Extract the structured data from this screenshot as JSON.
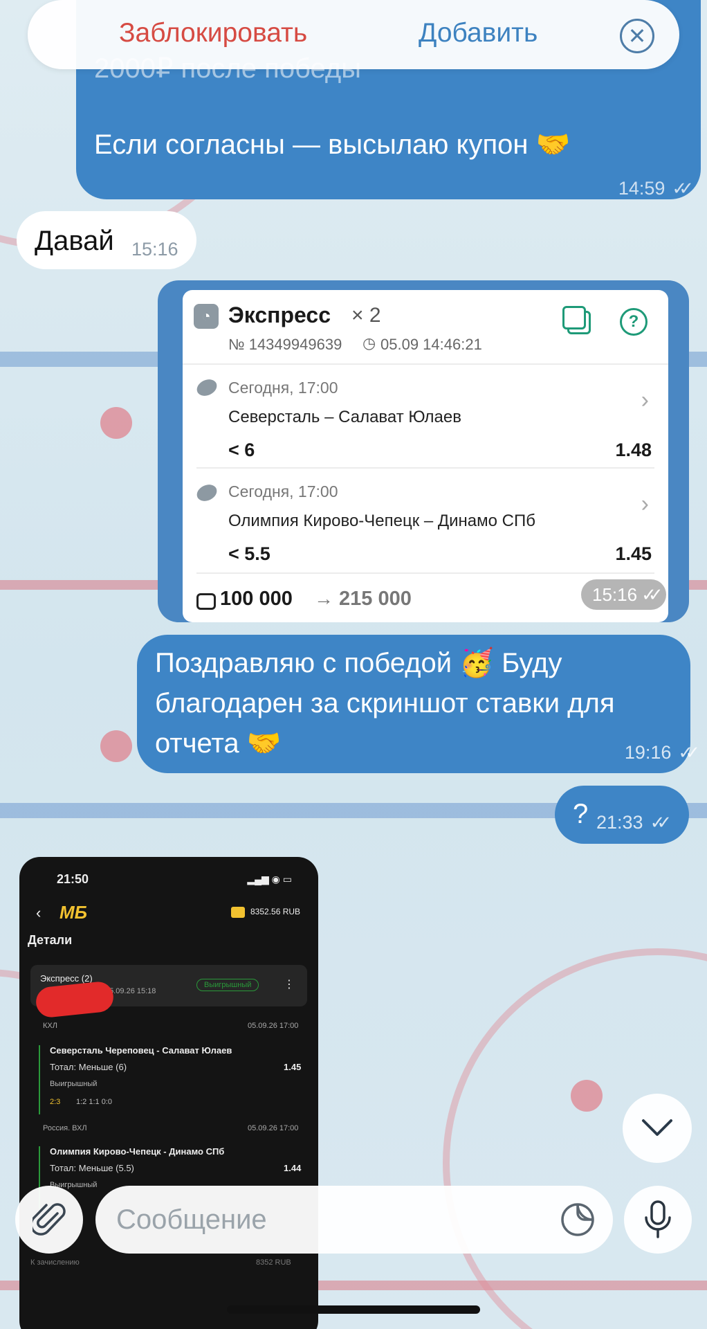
{
  "banner": {
    "block_label": "Заблокировать",
    "add_label": "Добавить"
  },
  "messages": {
    "m1": {
      "partial_text": "2000₽ после победы",
      "text": "Если согласны — высылаю купон 🤝",
      "time": "14:59"
    },
    "m2": {
      "text": "Давай",
      "time": "15:16"
    },
    "m3": {
      "text": "Поздравляю с победой 🥳 Буду благодарен за скриншот ставки для отчета 🤝",
      "time": "19:16"
    },
    "m4": {
      "text": "?",
      "time": "21:33"
    }
  },
  "bet_card": {
    "title": "Экспресс",
    "multiplier": "× 2",
    "ticket": "№ 14349949639",
    "datetime": "05.09 14:46:21",
    "legs": [
      {
        "when": "Сегодня, 17:00",
        "match": "Северсталь – Салават Юлаев",
        "selection": "< 6",
        "odds": "1.48"
      },
      {
        "when": "Сегодня, 17:00",
        "match": "Олимпия Кирово-Чепецк – Динамо СПб",
        "selection": "< 5.5",
        "odds": "1.45"
      }
    ],
    "stake": "100 000",
    "arrow": "→",
    "payout": "215 000",
    "time": "15:16"
  },
  "screenshot": {
    "status_time": "21:50",
    "logo": "МБ",
    "balance": "8352.56 RUB",
    "details_title": "Детали",
    "bet_title": "Экспресс (2)",
    "bet_date": "05.09.26 15:18",
    "won_badge": "Выигрышный",
    "leg1": {
      "league": "КХЛ",
      "date": "05.09.26 17:00",
      "match": "Северсталь Череповец - Салават Юлаев",
      "market": "Тотал: Меньше (6)",
      "odds": "1.45",
      "status": "Выигрышный",
      "score": "2:3",
      "periods": "1:2  1:1  0:0"
    },
    "leg2": {
      "league": "Россия. ВХЛ",
      "date": "05.09.26 17:00",
      "match": "Олимпия Кирово-Чепецк - Динамо СПб",
      "market": "Тотал: Меньше (5.5)",
      "odds": "1.44",
      "status": "Выигрышный"
    },
    "credit_label": "К зачислению",
    "credit_value": "8352 RUB"
  },
  "composer": {
    "placeholder": "Сообщение"
  },
  "icons": {
    "close": "close-icon",
    "attach": "paperclip-icon",
    "sticker": "sticker-icon",
    "mic": "microphone-icon",
    "scroll": "chevron-down-icon"
  },
  "colors": {
    "outgoing": "#3e85c6",
    "incoming": "#ffffff",
    "block": "#d64b43",
    "add": "#3d82c0",
    "accent_green": "#1e9a78"
  }
}
